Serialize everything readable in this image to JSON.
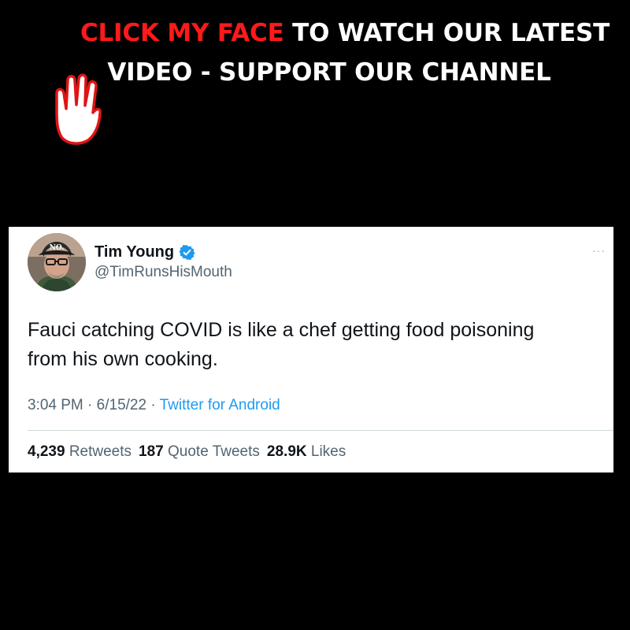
{
  "banner": {
    "highlight": "CLICK MY FACE",
    "line1_rest": " TO WATCH OUR LATEST",
    "line2": "VIDEO - SUPPORT OUR CHANNEL",
    "icon": "hand-click-icon"
  },
  "tweet": {
    "author_name": "Tim Young",
    "handle": "@TimRunsHisMouth",
    "verified_icon": "verified-badge-icon",
    "avatar_cap_text": "NO.",
    "text_line1": "Fauci catching COVID is like a chef getting food poisoning",
    "text_line2": "from his own cooking.",
    "time": "3:04 PM",
    "sep1": " · ",
    "date": "6/15/22",
    "sep2": " · ",
    "source": "Twitter for Android",
    "more_icon": "···",
    "stats": {
      "retweets_count": "4,239",
      "retweets_label": " Retweets",
      "quotes_count": "187",
      "quotes_label": " Quote Tweets",
      "likes_count": "28.9K",
      "likes_label": " Likes"
    }
  },
  "colors": {
    "background": "#000000",
    "banner_highlight": "#ff1a1a",
    "banner_text": "#ffffff",
    "link": "#1d9bf0",
    "verified": "#1d9bf0",
    "muted_text": "#536471"
  }
}
